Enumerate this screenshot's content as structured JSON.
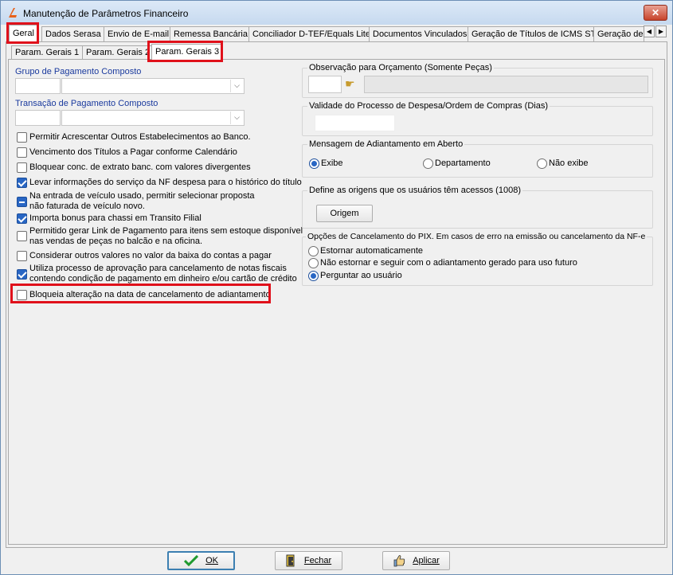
{
  "window": {
    "title": "Manutenção de Parâmetros Financeiro",
    "close_glyph": "✕"
  },
  "tabs": [
    {
      "label": "Geral",
      "active": true
    },
    {
      "label": "Dados Serasa"
    },
    {
      "label": "Envio de E-mail"
    },
    {
      "label": "Remessa Bancária"
    },
    {
      "label": "Conciliador D-TEF/Equals Lite"
    },
    {
      "label": "Documentos Vinculados"
    },
    {
      "label": "Geração de Títulos de ICMS ST"
    },
    {
      "label": "Geração de Pagamento"
    }
  ],
  "tab_scroll": {
    "left": "◀",
    "right": "▶"
  },
  "subtabs": [
    {
      "label": "Param. Gerais 1"
    },
    {
      "label": "Param. Gerais 2"
    },
    {
      "label": "Param. Gerais 3",
      "active": true
    }
  ],
  "left": {
    "grupo_label": "Grupo de Pagamento Composto",
    "transacao_label": "Transação de Pagamento Composto",
    "combo_arrow": "⌵",
    "checkboxes": [
      {
        "label": "Permitir Acrescentar Outros Estabelecimentos ao Banco.",
        "state": "unchecked"
      },
      {
        "label": "Vencimento dos Títulos a Pagar conforme Calendário",
        "state": "unchecked"
      },
      {
        "label": "Bloquear conc. de extrato banc. com valores divergentes",
        "state": "unchecked"
      },
      {
        "label": "Levar informações do serviço da NF despesa para o histórico do título",
        "state": "checked"
      },
      {
        "line1": "Na entrada de veículo usado, permitir selecionar proposta",
        "line2": "não faturada de veículo novo.",
        "state": "indeterminate"
      },
      {
        "label": "Importa bonus para chassi em Transito Filial",
        "state": "checked"
      },
      {
        "line1": "Permitido gerar Link de Pagamento para itens sem estoque disponível",
        "line2": "nas vendas de peças no balcão e na oficina.",
        "state": "unchecked"
      },
      {
        "label": "Considerar outros valores no valor da baixa do contas a pagar",
        "state": "unchecked"
      },
      {
        "line1": "Utiliza processo de aprovação para cancelamento de notas fiscais",
        "line2": "contendo condição de pagamento em dinheiro e/ou cartão de crédito",
        "state": "checked"
      },
      {
        "label": "Bloqueia alteração na data de cancelamento de adiantamento",
        "state": "unchecked"
      }
    ]
  },
  "right": {
    "observacao": {
      "title": "Observação para Orçamento (Somente Peças)"
    },
    "validade": {
      "title": "Validade do Processo de Despesa/Ordem de Compras (Dias)"
    },
    "mensagem": {
      "title": "Mensagem de Adiantamento em Aberto",
      "options": [
        "Exibe",
        "Departamento",
        "Não exibe"
      ],
      "selected": "Exibe"
    },
    "origens": {
      "title": "Define as origens que os usuários têm acessos (1008)",
      "button": "Origem"
    },
    "cancelamento_pix": {
      "title": "Opções de Cancelamento do PIX. Em casos de erro na emissão ou cancelamento da NF-e",
      "options": [
        "Estornar automaticamente",
        "Não estornar e seguir com o adiantamento gerado para uso futuro",
        "Perguntar ao usuário"
      ],
      "selected": "Perguntar ao usuário"
    }
  },
  "footer": {
    "ok": "OK",
    "fechar": "Fechar",
    "aplicar": "Aplicar"
  },
  "colors": {
    "highlight": "#e0111b",
    "label_blue": "#1a3a9e",
    "check_blue": "#2866c4"
  }
}
